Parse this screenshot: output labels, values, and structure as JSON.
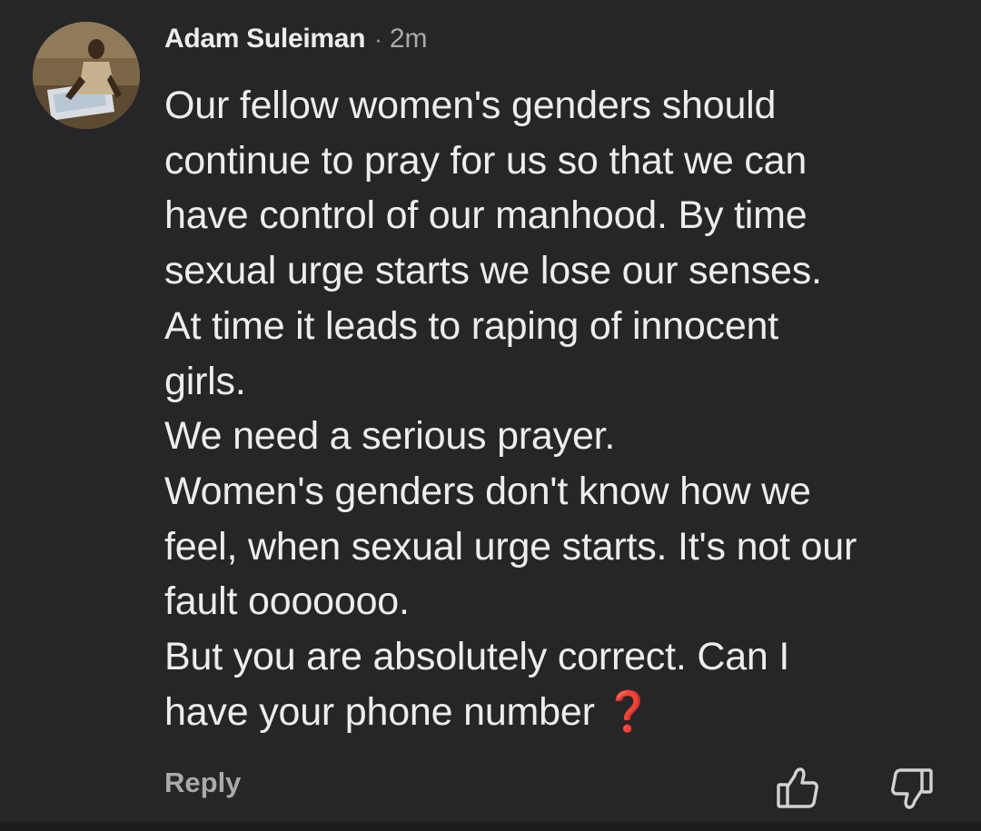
{
  "comment": {
    "author": "Adam Suleiman",
    "separator": "·",
    "time": "2m",
    "lines": [
      "Our fellow women's genders should",
      "continue to pray for us so that we can",
      "have control of our manhood. By time",
      "sexual urge starts we lose our senses.",
      "At time it leads to raping of innocent",
      "girls.",
      "We need a serious prayer.",
      "Women's genders don't know how we",
      "feel, when sexual urge starts. It's not our",
      "fault ooooooo.",
      "But you are absolutely correct.  Can I",
      "have your phone number"
    ],
    "emoji": "❓"
  },
  "actions": {
    "reply_label": "Reply",
    "like_icon": "thumbs-up-icon",
    "dislike_icon": "thumbs-down-icon"
  },
  "colors": {
    "background": "#262628",
    "text": "#ededed",
    "muted": "#a9a9ab",
    "emoji_red": "#e0322f"
  }
}
